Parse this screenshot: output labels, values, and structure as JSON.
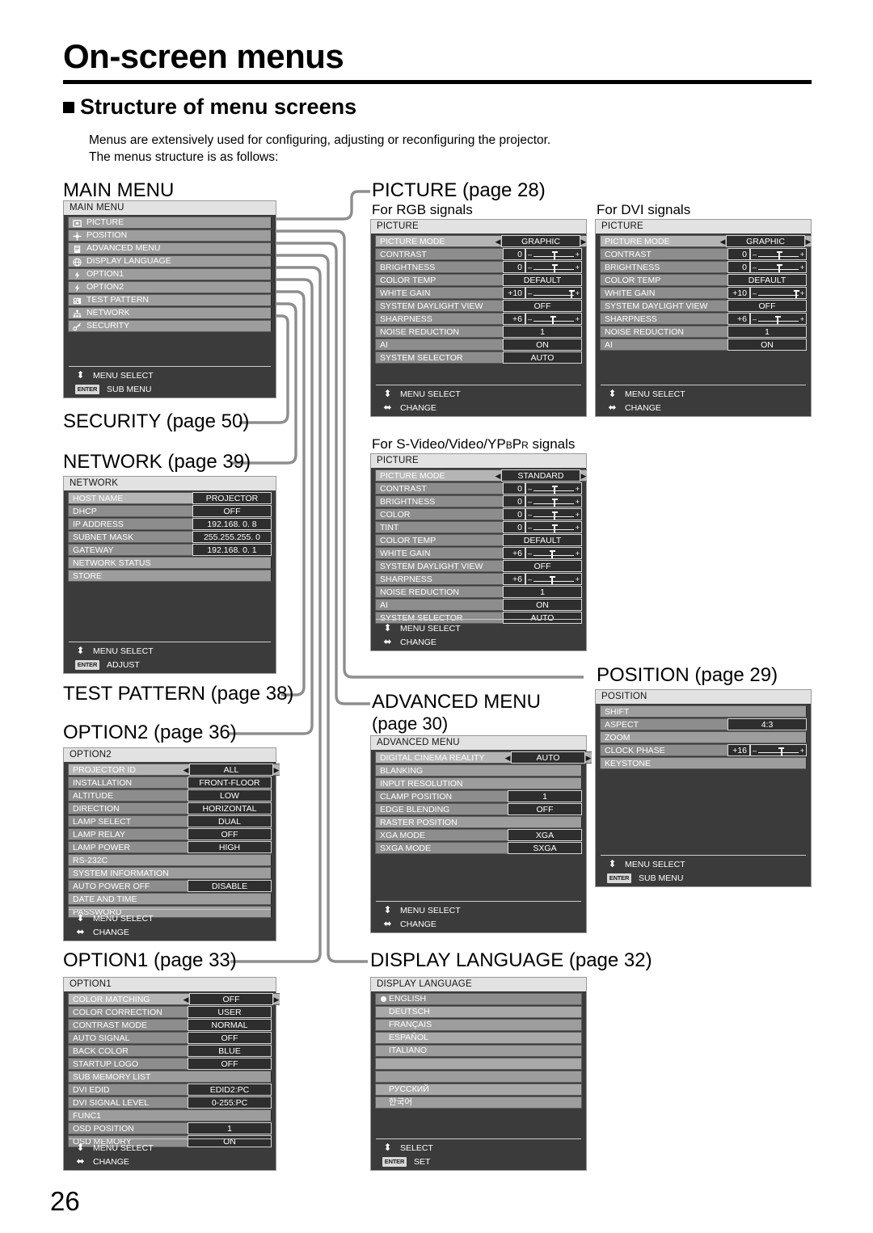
{
  "document": {
    "title": "On-screen menus",
    "section_heading": "Structure of menu screens",
    "intro_line1": "Menus are extensively used for configuring, adjusting or reconfiguring the projector.",
    "intro_line2": "The menus structure is as follows:",
    "page_number": "26"
  },
  "captions": {
    "main_menu": "MAIN MENU",
    "picture": "PICTURE (page 28)",
    "picture_rgb": "For RGB signals",
    "picture_dvi": "For DVI signals",
    "picture_svideo": "For S-Video/Video/YPBPR signals",
    "security": "SECURITY (page 50)",
    "network": "NETWORK (page 39)",
    "test_pattern": "TEST PATTERN (page 38)",
    "option2": "OPTION2 (page 36)",
    "option1": "OPTION1 (page 33)",
    "advanced_menu_l1": "ADVANCED MENU",
    "advanced_menu_l2": "(page 30)",
    "position": "POSITION (page 29)",
    "display_language": "DISPLAY LANGUAGE (page 32)"
  },
  "guides": {
    "menu_select": "MENU SELECT",
    "sub_menu": "SUB MENU",
    "change": "CHANGE",
    "adjust": "ADJUST",
    "select": "SELECT",
    "set": "SET",
    "enter": "ENTER",
    "up_down_glyph": "⬍",
    "left_right_glyph": "⬌"
  },
  "main_menu": {
    "title": "MAIN MENU",
    "items": [
      {
        "label": "PICTURE",
        "icon": "picture-icon",
        "highlighted": true
      },
      {
        "label": "POSITION",
        "icon": "position-icon",
        "highlighted": false
      },
      {
        "label": "ADVANCED MENU",
        "icon": "advanced-menu-icon",
        "highlighted": false
      },
      {
        "label": "DISPLAY LANGUAGE",
        "icon": "globe-icon",
        "highlighted": false
      },
      {
        "label": "OPTION1",
        "icon": "option1-icon",
        "highlighted": false
      },
      {
        "label": "OPTION2",
        "icon": "option2-icon",
        "highlighted": false
      },
      {
        "label": "TEST PATTERN",
        "icon": "test-pattern-icon",
        "highlighted": false
      },
      {
        "label": "NETWORK",
        "icon": "network-icon",
        "highlighted": false
      },
      {
        "label": "SECURITY",
        "icon": "security-key-icon",
        "highlighted": false
      }
    ]
  },
  "picture_rgb": {
    "title": "PICTURE",
    "rows": [
      {
        "label": "PICTURE MODE",
        "value": "GRAPHIC",
        "type": "cycle",
        "highlighted": true
      },
      {
        "label": "CONTRAST",
        "value": "0",
        "type": "slider",
        "knob": 50
      },
      {
        "label": "BRIGHTNESS",
        "value": "0",
        "type": "slider",
        "knob": 50
      },
      {
        "label": "COLOR TEMP",
        "value": "DEFAULT",
        "type": "value"
      },
      {
        "label": "WHITE GAIN",
        "value": "+10",
        "type": "slider",
        "knob": 92
      },
      {
        "label": "SYSTEM DAYLIGHT VIEW",
        "value": "OFF",
        "type": "value"
      },
      {
        "label": "SHARPNESS",
        "value": "+6",
        "type": "slider",
        "knob": 46
      },
      {
        "label": "NOISE REDUCTION",
        "value": "1",
        "type": "value"
      },
      {
        "label": "AI",
        "value": "ON",
        "type": "value"
      },
      {
        "label": "SYSTEM SELECTOR",
        "value": "AUTO",
        "type": "value"
      }
    ]
  },
  "picture_dvi": {
    "title": "PICTURE",
    "rows": [
      {
        "label": "PICTURE MODE",
        "value": "GRAPHIC",
        "type": "cycle",
        "highlighted": true
      },
      {
        "label": "CONTRAST",
        "value": "0",
        "type": "slider",
        "knob": 50
      },
      {
        "label": "BRIGHTNESS",
        "value": "0",
        "type": "slider",
        "knob": 50
      },
      {
        "label": "COLOR TEMP",
        "value": "DEFAULT",
        "type": "value"
      },
      {
        "label": "WHITE GAIN",
        "value": "+10",
        "type": "slider",
        "knob": 92
      },
      {
        "label": "SYSTEM DAYLIGHT VIEW",
        "value": "OFF",
        "type": "value"
      },
      {
        "label": "SHARPNESS",
        "value": "+6",
        "type": "slider",
        "knob": 46
      },
      {
        "label": "NOISE REDUCTION",
        "value": "1",
        "type": "value"
      },
      {
        "label": "AI",
        "value": "ON",
        "type": "value"
      }
    ]
  },
  "picture_svideo": {
    "title": "PICTURE",
    "rows": [
      {
        "label": "PICTURE MODE",
        "value": "STANDARD",
        "type": "cycle",
        "highlighted": true
      },
      {
        "label": "CONTRAST",
        "value": "0",
        "type": "slider",
        "knob": 50
      },
      {
        "label": "BRIGHTNESS",
        "value": "0",
        "type": "slider",
        "knob": 50
      },
      {
        "label": "COLOR",
        "value": "0",
        "type": "slider",
        "knob": 50
      },
      {
        "label": "TINT",
        "value": "0",
        "type": "slider",
        "knob": 50
      },
      {
        "label": "COLOR TEMP",
        "value": "DEFAULT",
        "type": "value"
      },
      {
        "label": "WHITE GAIN",
        "value": "+6",
        "type": "slider",
        "knob": 44
      },
      {
        "label": "SYSTEM DAYLIGHT VIEW",
        "value": "OFF",
        "type": "value"
      },
      {
        "label": "SHARPNESS",
        "value": "+6",
        "type": "slider",
        "knob": 44
      },
      {
        "label": "NOISE REDUCTION",
        "value": "1",
        "type": "value"
      },
      {
        "label": "AI",
        "value": "ON",
        "type": "value"
      },
      {
        "label": "SYSTEM SELECTOR",
        "value": "AUTO",
        "type": "value"
      }
    ]
  },
  "network": {
    "title": "NETWORK",
    "rows": [
      {
        "label": "HOST NAME",
        "value": "PROJECTOR",
        "type": "value",
        "highlighted": true
      },
      {
        "label": "DHCP",
        "value": "OFF",
        "type": "value"
      },
      {
        "label": "IP ADDRESS",
        "value": "192.168.  0.  8",
        "type": "value"
      },
      {
        "label": "SUBNET MASK",
        "value": "255.255.255.  0",
        "type": "value"
      },
      {
        "label": "GATEWAY",
        "value": "192.168.  0.  1",
        "type": "value"
      },
      {
        "label": "NETWORK STATUS",
        "type": "submenu"
      },
      {
        "label": "STORE",
        "type": "submenu"
      }
    ]
  },
  "option2": {
    "title": "OPTION2",
    "rows": [
      {
        "label": "PROJECTOR ID",
        "value": "ALL",
        "type": "cycle",
        "highlighted": true
      },
      {
        "label": "INSTALLATION",
        "value": "FRONT-FLOOR",
        "type": "value"
      },
      {
        "label": "ALTITUDE",
        "value": "LOW",
        "type": "value"
      },
      {
        "label": "DIRECTION",
        "value": "HORIZONTAL",
        "type": "value"
      },
      {
        "label": "LAMP SELECT",
        "value": "DUAL",
        "type": "value"
      },
      {
        "label": "LAMP RELAY",
        "value": "OFF",
        "type": "value"
      },
      {
        "label": "LAMP POWER",
        "value": "HIGH",
        "type": "value"
      },
      {
        "label": "RS-232C",
        "type": "submenu"
      },
      {
        "label": "SYSTEM INFORMATION",
        "type": "submenu"
      },
      {
        "label": "AUTO POWER OFF",
        "value": "DISABLE",
        "type": "value"
      },
      {
        "label": "DATE AND TIME",
        "type": "submenu"
      },
      {
        "label": "PASSWORD",
        "type": "submenu"
      }
    ]
  },
  "option1": {
    "title": "OPTION1",
    "rows": [
      {
        "label": "COLOR MATCHING",
        "value": "OFF",
        "type": "cycle",
        "highlighted": true
      },
      {
        "label": "COLOR CORRECTION",
        "value": "USER",
        "type": "value"
      },
      {
        "label": "CONTRAST MODE",
        "value": "NORMAL",
        "type": "value"
      },
      {
        "label": "AUTO SIGNAL",
        "value": "OFF",
        "type": "value"
      },
      {
        "label": "BACK COLOR",
        "value": "BLUE",
        "type": "value"
      },
      {
        "label": "STARTUP LOGO",
        "value": "OFF",
        "type": "value"
      },
      {
        "label": "SUB MEMORY LIST",
        "type": "submenu"
      },
      {
        "label": "DVI EDID",
        "value": "EDID2:PC",
        "type": "value"
      },
      {
        "label": "DVI SIGNAL LEVEL",
        "value": "0-255:PC",
        "type": "value"
      },
      {
        "label": "FUNC1",
        "type": "submenu"
      },
      {
        "label": "OSD POSITION",
        "value": "1",
        "type": "value"
      },
      {
        "label": "OSD MEMORY",
        "value": "ON",
        "type": "value"
      }
    ]
  },
  "advanced_menu": {
    "title": "ADVANCED MENU",
    "rows": [
      {
        "label": "DIGITAL CINEMA REALITY",
        "value": "AUTO",
        "type": "cycle",
        "highlighted": true
      },
      {
        "label": "BLANKING",
        "type": "submenu"
      },
      {
        "label": "INPUT RESOLUTION",
        "type": "submenu"
      },
      {
        "label": "CLAMP POSITION",
        "value": "1",
        "type": "value"
      },
      {
        "label": "EDGE BLENDING",
        "value": "OFF",
        "type": "value"
      },
      {
        "label": "RASTER POSITION",
        "type": "submenu"
      },
      {
        "label": "XGA MODE",
        "value": "XGA",
        "type": "value"
      },
      {
        "label": "SXGA MODE",
        "value": "SXGA",
        "type": "value"
      }
    ]
  },
  "position": {
    "title": "POSITION",
    "rows": [
      {
        "label": "SHIFT",
        "type": "submenu",
        "highlighted": true
      },
      {
        "label": "ASPECT",
        "value": "4:3",
        "type": "value"
      },
      {
        "label": "ZOOM",
        "type": "submenu"
      },
      {
        "label": "CLOCK PHASE",
        "value": "+16",
        "type": "slider",
        "knob": 55
      },
      {
        "label": "KEYSTONE",
        "type": "submenu"
      }
    ]
  },
  "display_language": {
    "title": "DISPLAY LANGUAGE",
    "items": [
      {
        "label": "ENGLISH",
        "selected": true
      },
      {
        "label": "DEUTSCH",
        "selected": false
      },
      {
        "label": "FRANÇAIS",
        "selected": false
      },
      {
        "label": "ESPAÑOL",
        "selected": false
      },
      {
        "label": "ITALIANO",
        "selected": false
      },
      {
        "label": "",
        "selected": false
      },
      {
        "label": "",
        "selected": false
      },
      {
        "label": "РУССКИЙ",
        "selected": false
      },
      {
        "label": "한국어",
        "selected": false
      }
    ]
  }
}
